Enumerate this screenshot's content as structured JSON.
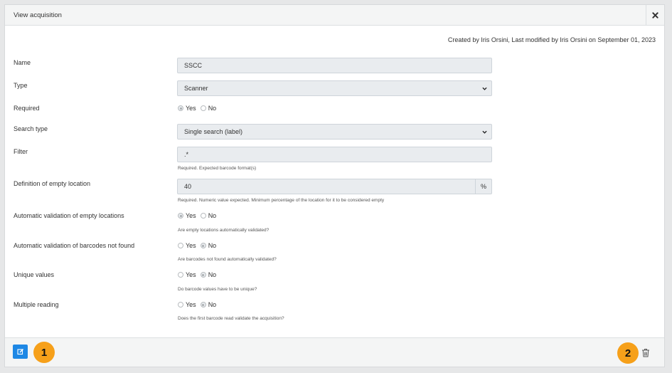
{
  "modal": {
    "title": "View acquisition",
    "meta": "Created by Iris Orsini, Last modified by Iris Orsini on September 01, 2023"
  },
  "fields": {
    "name": {
      "label": "Name",
      "value": "SSCC"
    },
    "type": {
      "label": "Type",
      "value": "Scanner"
    },
    "required": {
      "label": "Required",
      "yes": "Yes",
      "no": "No",
      "selected": "Yes"
    },
    "search_type": {
      "label": "Search type",
      "value": "Single search (label)"
    },
    "filter": {
      "label": "Filter",
      "value": ".*",
      "help": "Required. Expected barcode format(s)"
    },
    "empty_location": {
      "label": "Definition of empty location",
      "value": "40",
      "unit": "%",
      "help": "Required. Numeric value expected. Minimum percentage of the location for it to be considered empty"
    },
    "auto_validate_empty": {
      "label": "Automatic validation of empty locations",
      "yes": "Yes",
      "no": "No",
      "selected": "Yes",
      "help": "Are empty locations automatically validated?"
    },
    "auto_validate_not_found": {
      "label": "Automatic validation of barcodes not found",
      "yes": "Yes",
      "no": "No",
      "selected": "No",
      "help": "Are barcodes not found automatically validated?"
    },
    "unique_values": {
      "label": "Unique values",
      "yes": "Yes",
      "no": "No",
      "selected": "No",
      "help": "Do barcode values have to be unique?"
    },
    "multiple_reading": {
      "label": "Multiple reading",
      "yes": "Yes",
      "no": "No",
      "selected": "No",
      "help": "Does the first barcode read validate the acquisition?"
    }
  },
  "annotations": {
    "badge_1": "1",
    "badge_2": "2"
  },
  "colors": {
    "accent": "#1e88e5",
    "badge": "#f6a01a",
    "field_bg": "#e9ecef"
  },
  "icons": {
    "close": "close-icon",
    "edit": "edit-icon",
    "delete": "trash-icon",
    "dropdown": "chevron-down-icon"
  }
}
